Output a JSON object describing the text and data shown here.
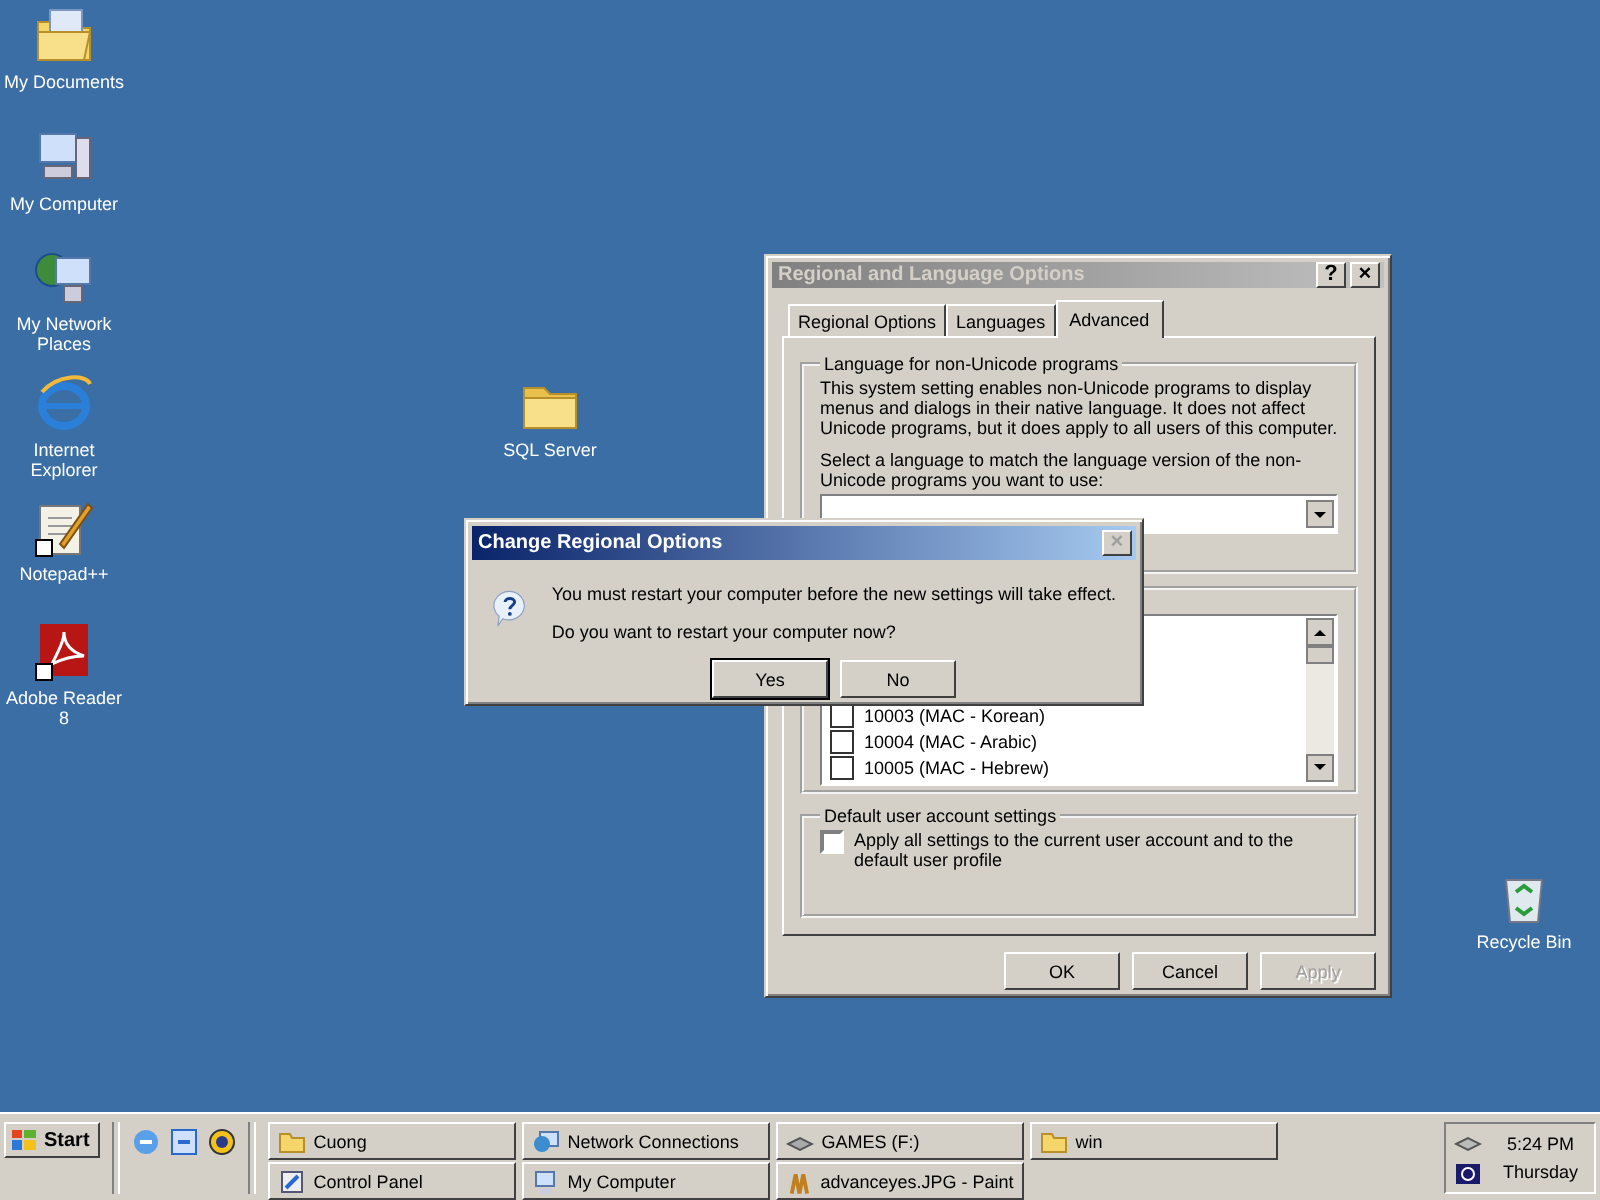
{
  "desktop_icons": [
    {
      "label": "My Documents"
    },
    {
      "label": "My Computer"
    },
    {
      "label": "My Network Places"
    },
    {
      "label": "Internet Explorer"
    },
    {
      "label": "Notepad++"
    },
    {
      "label": "Adobe Reader 8"
    },
    {
      "label": "SQL Server"
    },
    {
      "label": "Recycle Bin"
    }
  ],
  "dialog": {
    "title": "Regional and Language Options",
    "active": false,
    "title_buttons": [
      "?",
      "×"
    ],
    "tabs": [
      {
        "label": "Regional Options",
        "selected": false
      },
      {
        "label": "Languages",
        "selected": false
      },
      {
        "label": "Advanced",
        "selected": true
      }
    ],
    "language_group": {
      "title": "Language for non-Unicode programs",
      "description": "This system setting enables non-Unicode programs to display menus and dialogs in their native language. It does not affect Unicode programs, but it does apply to all users of this computer.",
      "prompt": "Select a language to match the language version of the non-Unicode programs you want to use:"
    },
    "code_pages": [
      {
        "label": "10003 (MAC - Korean)",
        "checked": false
      },
      {
        "label": "10004 (MAC - Arabic)",
        "checked": false
      },
      {
        "label": "10005 (MAC - Hebrew)",
        "checked": false
      }
    ],
    "user_group": {
      "title": "Default user account settings",
      "label": "Apply all settings to the current user account and to the default user profile",
      "checked": false
    },
    "buttons": [
      {
        "label": "OK",
        "disabled": false
      },
      {
        "label": "Cancel",
        "disabled": false
      },
      {
        "label": "Apply",
        "disabled": true
      }
    ]
  },
  "message_box": {
    "title": "Change Regional Options",
    "active": true,
    "close": "×",
    "close_disabled": true,
    "message": "You must restart your computer before the new settings will take effect.",
    "question": "Do you want to restart your computer now?",
    "buttons": [
      "Yes",
      "No"
    ]
  },
  "taskbar": {
    "start": "Start",
    "tasks": [
      {
        "label": "Cuong"
      },
      {
        "label": "Network Connections"
      },
      {
        "label": "GAMES (F:)"
      },
      {
        "label": "win"
      },
      {
        "label": "Control Panel"
      },
      {
        "label": "My Computer"
      },
      {
        "label": "advanceyes.JPG - Paint"
      }
    ],
    "time": "5:24 PM",
    "day": "Thursday"
  }
}
